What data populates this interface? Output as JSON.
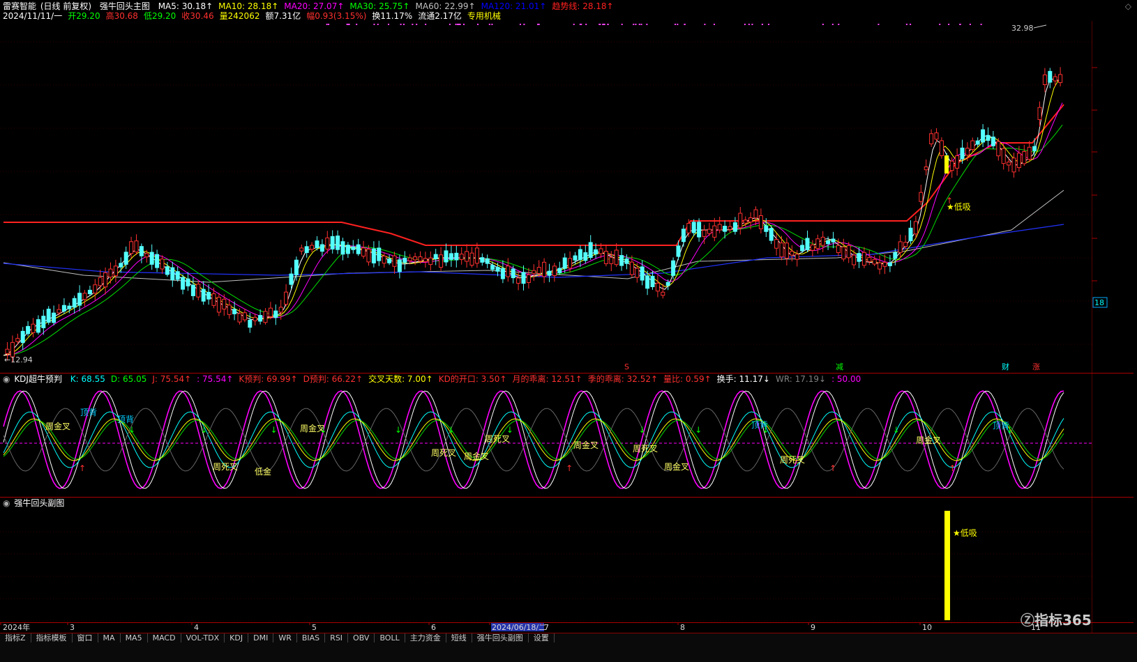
{
  "main": {
    "title": "雷赛智能",
    "period": "(日线 前复权)",
    "indicator": "强牛回头主图",
    "ma": [
      {
        "label": "MA5: 30.18↑",
        "color": "#ffffff"
      },
      {
        "label": "MA10: 28.18↑",
        "color": "#ffff00"
      },
      {
        "label": "MA20: 27.07↑",
        "color": "#ff00ff"
      },
      {
        "label": "MA30: 25.75↑",
        "color": "#00ff00"
      },
      {
        "label": "MA60: 22.99↑",
        "color": "#c0c0c0"
      },
      {
        "label": "MA120: 21.01↑",
        "color": "#0000ff"
      },
      {
        "label": "趋势线: 28.18↑",
        "color": "#ff2020"
      }
    ],
    "info": [
      {
        "label": "2024/11/11/一",
        "color": "#ffffff"
      },
      {
        "label": "开29.20",
        "color": "#00ff00"
      },
      {
        "label": "高30.68",
        "color": "#ff3030"
      },
      {
        "label": "低29.20",
        "color": "#00ff00"
      },
      {
        "label": "收30.46",
        "color": "#ff3030"
      },
      {
        "label": "量242062",
        "color": "#ffff00"
      },
      {
        "label": "额7.31亿",
        "color": "#ffffff"
      },
      {
        "label": "幅0.93(3.15%)",
        "color": "#ff3030"
      },
      {
        "label": "换11.17%",
        "color": "#ffffff"
      },
      {
        "label": "流通2.17亿",
        "color": "#ffffff"
      },
      {
        "label": "专用机械",
        "color": "#ffff00"
      }
    ],
    "high_price": "32.98",
    "low_price": "12.94",
    "low_buy_label": "★低吸",
    "event_markers": [
      {
        "label": "S",
        "color": "#ff3030"
      },
      {
        "label": "减",
        "color": "#00ff00"
      },
      {
        "label": "财",
        "color": "#00ffff"
      },
      {
        "label": "涨",
        "color": "#ff3030"
      }
    ],
    "right_badge": "18"
  },
  "kdj": {
    "title": "KDJ超牛预判",
    "values": [
      {
        "label": "K: 68.55",
        "color": "#00ffff"
      },
      {
        "label": "D: 65.05",
        "color": "#00ff00"
      },
      {
        "label": "J: 75.54↑",
        "color": "#ff3030"
      },
      {
        "label": ": 75.54↑",
        "color": "#ff00ff"
      },
      {
        "label": "K预判: 69.99↑",
        "color": "#ff3030"
      },
      {
        "label": "D预判: 66.22↑",
        "color": "#ff3030"
      },
      {
        "label": "交叉天数: 7.00↑",
        "color": "#ffff00"
      },
      {
        "label": "KD的开口: 3.50↑",
        "color": "#ff3030"
      },
      {
        "label": "月的乖离: 12.51↑",
        "color": "#ff3030"
      },
      {
        "label": "季的乖离: 32.52↑",
        "color": "#ff3030"
      },
      {
        "label": "量比: 0.59↑",
        "color": "#ff3030"
      },
      {
        "label": "换手: 11.17↓",
        "color": "#ffffff"
      },
      {
        "label": "WR: 17.19↓",
        "color": "#808080"
      },
      {
        "label": ": 50.00",
        "color": "#ff00ff"
      }
    ],
    "annotations": [
      "周金叉",
      "顶背",
      "顶背",
      "周金叉",
      "周死叉",
      "低金",
      "周死叉",
      "周金叉",
      "周死叉",
      "周金叉",
      "周死叉",
      "周金叉",
      "顶背",
      "周死叉",
      "周金叉",
      "顶背"
    ]
  },
  "sub": {
    "title": "强牛回头副图",
    "signal_label": "★低吸"
  },
  "xaxis": {
    "labels": [
      "2024年",
      "3",
      "4",
      "5",
      "6",
      "2024/06/18/二",
      "7",
      "8",
      "9",
      "10",
      "11"
    ]
  },
  "tabs": [
    "指标Z",
    "指标模板",
    "窗口",
    "MA",
    "MA5",
    "MACD",
    "VOL-TDX",
    "KDJ",
    "DMI",
    "WR",
    "BIAS",
    "RSI",
    "OBV",
    "BOLL",
    "主力资金",
    "短线",
    "强牛回头副图",
    "设置"
  ],
  "watermark": "指标365",
  "colors": {
    "up": "#ff3030",
    "down": "#54ffff",
    "frame": "#aa0000"
  }
}
